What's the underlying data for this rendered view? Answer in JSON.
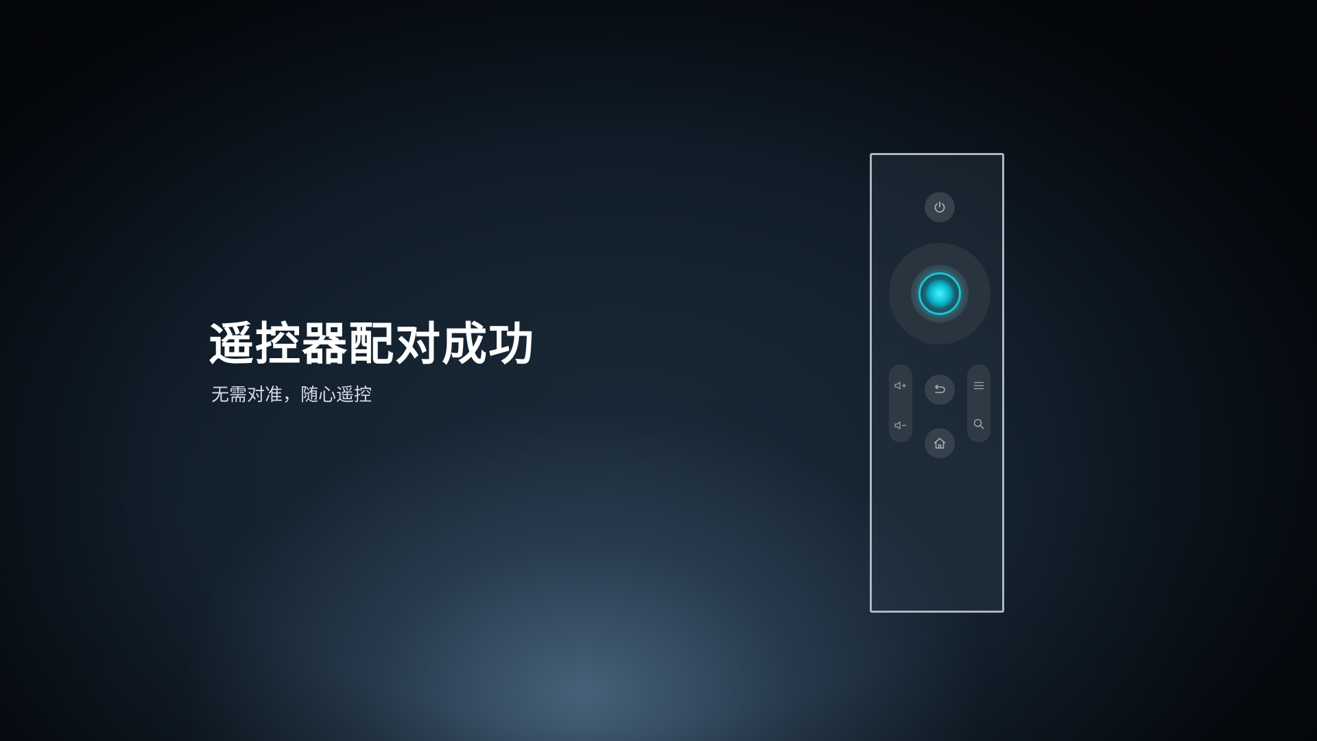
{
  "screen": {
    "headline": "遥控器配对成功",
    "subheadline": "无需对准，随心遥控"
  },
  "remote": {
    "buttons": [
      {
        "name": "power",
        "icon": "power-icon"
      },
      {
        "name": "ok",
        "icon": "glowing-center-key"
      },
      {
        "name": "volume-up",
        "icon": "volume-up-icon"
      },
      {
        "name": "volume-down",
        "icon": "volume-down-icon"
      },
      {
        "name": "back",
        "icon": "back-icon"
      },
      {
        "name": "home",
        "icon": "home-icon"
      },
      {
        "name": "menu",
        "icon": "menu-icon"
      },
      {
        "name": "search",
        "icon": "search-icon"
      }
    ],
    "accent_color": "#1ec3d6",
    "outline_color": "#aeb7c0"
  }
}
